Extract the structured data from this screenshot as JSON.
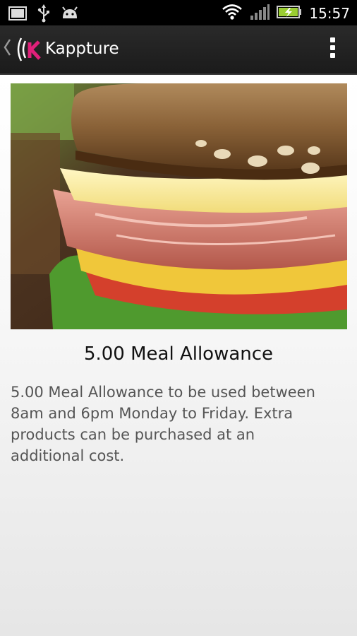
{
  "status_bar": {
    "time": "15:57",
    "icons": [
      "screenshot-icon",
      "usb-icon",
      "android-icon",
      "wifi-icon",
      "signal-icon",
      "battery-charging-icon"
    ]
  },
  "action_bar": {
    "title": "Kappture",
    "logo_letter": "K",
    "accent_color": "#e0207a",
    "icons": [
      "back-chevron-icon",
      "overflow-menu-icon"
    ]
  },
  "product": {
    "image": "sandwich-photo",
    "title": "5.00 Meal Allowance",
    "description": "5.00 Meal Allowance to be used between\n8am and 6pm Monday to Friday.  Extra\nproducts can be purchased at an\nadditional cost."
  }
}
